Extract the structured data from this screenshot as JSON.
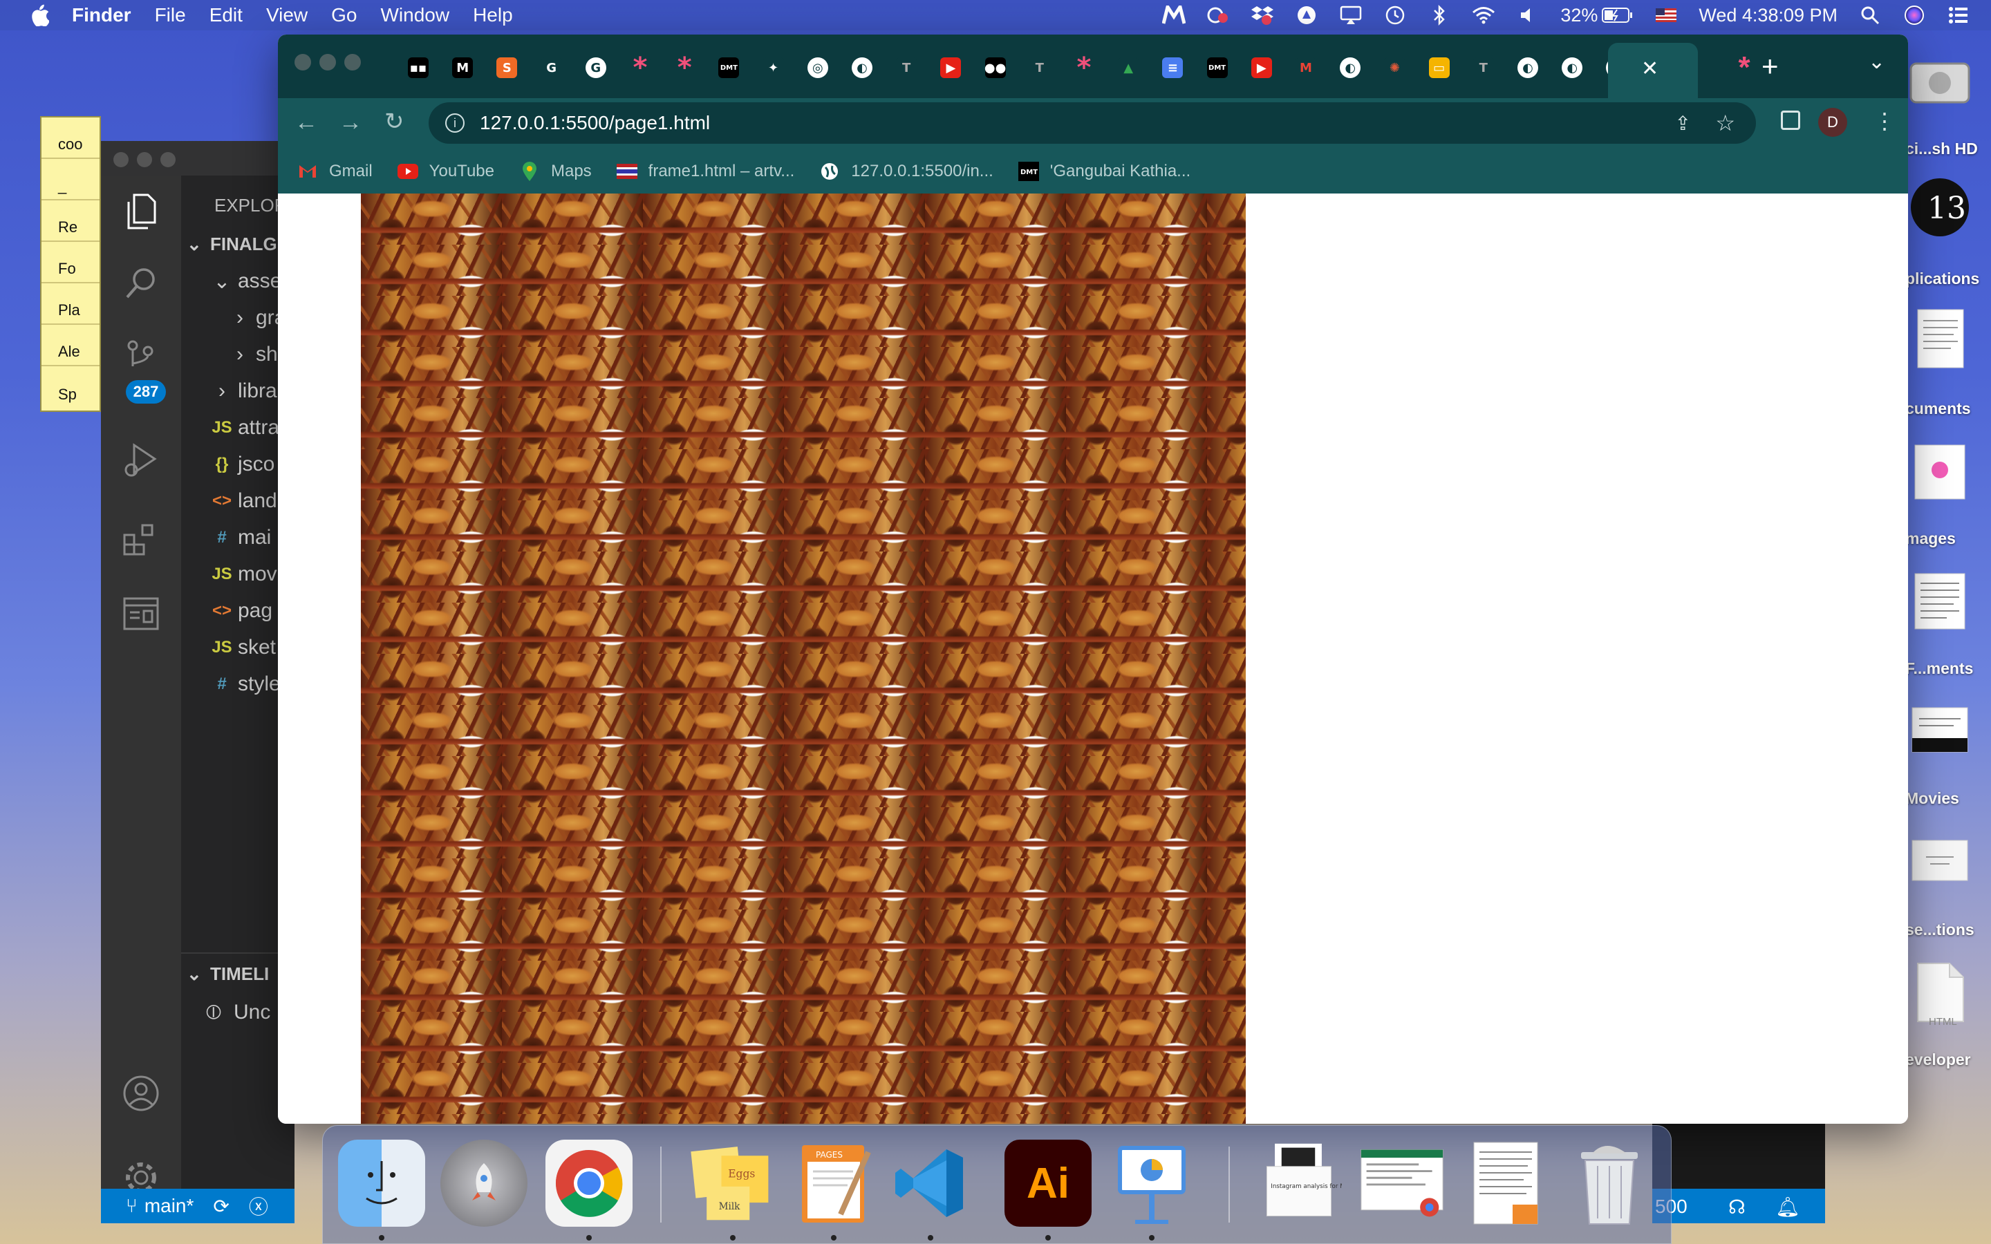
{
  "menubar": {
    "app_name": "Finder",
    "items": [
      "File",
      "Edit",
      "View",
      "Go",
      "Window",
      "Help"
    ],
    "battery": "32%",
    "datetime": "Wed 4:38:09 PM"
  },
  "stickies": {
    "lines": [
      "coo",
      "_",
      "Re",
      "Fo",
      "Pla",
      "Ale",
      "Sp"
    ]
  },
  "vscode": {
    "explorer_title": "EXPLOR",
    "folder": "FINALG",
    "source_control_badge": "287",
    "tree": [
      {
        "label": "asse",
        "icon": "chevron-down",
        "indent": 1
      },
      {
        "label": "gra",
        "icon": "chevron-right",
        "indent": 2
      },
      {
        "label": "sha",
        "icon": "chevron-right",
        "indent": 2
      },
      {
        "label": "libra",
        "icon": "chevron-right",
        "indent": 1
      },
      {
        "label": "attra",
        "icon": "JS",
        "indent": 1
      },
      {
        "label": "jsco",
        "icon": "{}",
        "indent": 1
      },
      {
        "label": "land",
        "icon": "<>",
        "indent": 1
      },
      {
        "label": "mai",
        "icon": "#",
        "indent": 1
      },
      {
        "label": "mov",
        "icon": "JS",
        "indent": 1
      },
      {
        "label": "pag",
        "icon": "<>",
        "indent": 1
      },
      {
        "label": "sket",
        "icon": "JS",
        "indent": 1
      },
      {
        "label": "style",
        "icon": "#",
        "indent": 1
      }
    ],
    "timeline_title": "TIMELI",
    "timeline_item": "Unc",
    "status_branch": "main*",
    "status_right": "500"
  },
  "chrome": {
    "url": "127.0.0.1:5500/page1.html",
    "profile_initial": "D",
    "bookmarks": [
      "Gmail",
      "YouTube",
      "Maps",
      "frame1.html – artv...",
      "127.0.0.1:5500/in...",
      "'Gangubai Kathia..."
    ],
    "tabs": [
      {
        "icon": "medium-dark",
        "color": "#000000",
        "text": "▪▪"
      },
      {
        "icon": "m-logo",
        "color": "#000000",
        "text": "M"
      },
      {
        "icon": "orange-s",
        "color": "#f06a25",
        "text": "S"
      },
      {
        "icon": "g-logo",
        "color": "#0c3a3e",
        "text": "G"
      },
      {
        "icon": "google",
        "color": "#ffffff",
        "text": "G"
      },
      {
        "icon": "asterisk",
        "color": "#0c3a3e",
        "text": "*"
      },
      {
        "icon": "asterisk",
        "color": "#0c3a3e",
        "text": "*"
      },
      {
        "icon": "dmt",
        "color": "#000000",
        "text": "DMT"
      },
      {
        "icon": "puzzle",
        "color": "#0c3a3e",
        "text": "✦"
      },
      {
        "icon": "target",
        "color": "#0c3a3e",
        "text": "◎"
      },
      {
        "icon": "globe",
        "color": "#0c3a3e",
        "text": "◐"
      },
      {
        "icon": "nyt",
        "color": "#0c3a3e",
        "text": "T"
      },
      {
        "icon": "youtube",
        "color": "#e62117",
        "text": "▶"
      },
      {
        "icon": "medium",
        "color": "#000000",
        "text": "●●"
      },
      {
        "icon": "nyt",
        "color": "#0c3a3e",
        "text": "T"
      },
      {
        "icon": "asterisk",
        "color": "#0c3a3e",
        "text": "*"
      },
      {
        "icon": "drive",
        "color": "#0c3a3e",
        "text": "▲"
      },
      {
        "icon": "docs",
        "color": "#4a7df0",
        "text": "≡"
      },
      {
        "icon": "dmt",
        "color": "#000000",
        "text": "DMT"
      },
      {
        "icon": "youtube",
        "color": "#e62117",
        "text": "▶"
      },
      {
        "icon": "gmail",
        "color": "#0c3a3e",
        "text": "M"
      },
      {
        "icon": "globe",
        "color": "#0c3a3e",
        "text": "◐"
      },
      {
        "icon": "sun",
        "color": "#0c3a3e",
        "text": "✺"
      },
      {
        "icon": "slides",
        "color": "#f5b400",
        "text": "▭"
      },
      {
        "icon": "nyt",
        "color": "#0c3a3e",
        "text": "T"
      },
      {
        "icon": "globe",
        "color": "#0c3a3e",
        "text": "◐"
      },
      {
        "icon": "globe",
        "color": "#0c3a3e",
        "text": "◐"
      },
      {
        "icon": "globe",
        "color": "#0c3a3e",
        "text": "◐"
      }
    ],
    "active_tab_close": "✕",
    "pinned_after": {
      "icon": "asterisk",
      "text": "*"
    },
    "new_tab": "+"
  },
  "desktop": {
    "items": [
      "ci...sh HD",
      "plications",
      "cuments",
      "mages",
      "F...ments",
      "Movies",
      "se...tions",
      "eveloper"
    ]
  },
  "dock": {
    "apps": [
      "Finder",
      "Launchpad",
      "Chrome",
      "Stickies",
      "Pages",
      "Visual Studio Code",
      "Illustrator",
      "Keynote"
    ],
    "stickies_note": "Eggs Milk",
    "illustrator_label": "Ai",
    "pages_label": "PAGES",
    "doc_caption": "Instagram analysis for Mood&Co",
    "html_doc": "HTML"
  }
}
